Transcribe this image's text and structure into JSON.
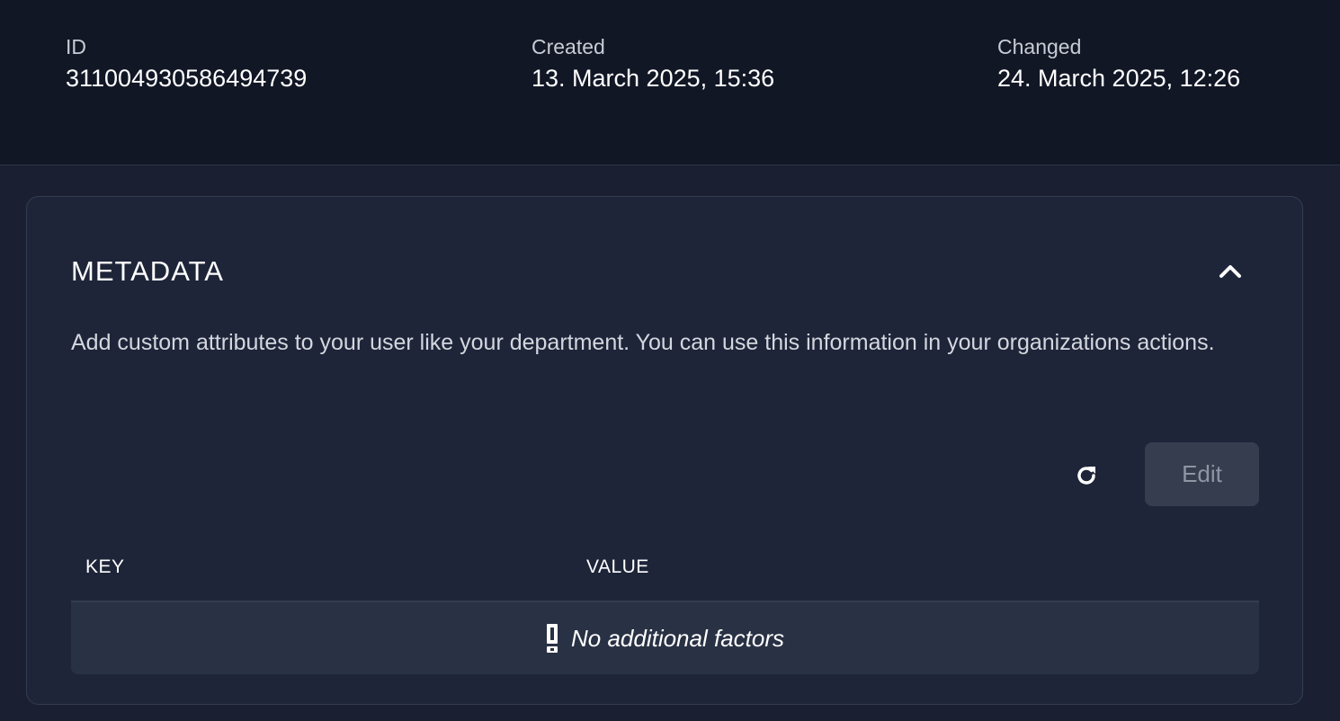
{
  "info": {
    "id_label": "ID",
    "id_value": "311004930586494739",
    "created_label": "Created",
    "created_value": "13. March 2025, 15:36",
    "changed_label": "Changed",
    "changed_value": "24. March 2025, 12:26"
  },
  "metadata": {
    "title": "METADATA",
    "description": "Add custom attributes to your user like your department. You can use this information in your organizations actions.",
    "collapse_icon": "chevron-up-icon",
    "refresh_icon": "refresh-icon",
    "edit_label": "Edit",
    "table": {
      "columns": [
        "KEY",
        "VALUE"
      ],
      "empty_message": "No additional factors",
      "empty_icon": "exclamation-icon"
    }
  },
  "colors": {
    "background": "#1a2032",
    "header_bar": "#121726",
    "card": "#1e2539",
    "empty_row": "#293144",
    "edit_button": "#363d4f"
  }
}
